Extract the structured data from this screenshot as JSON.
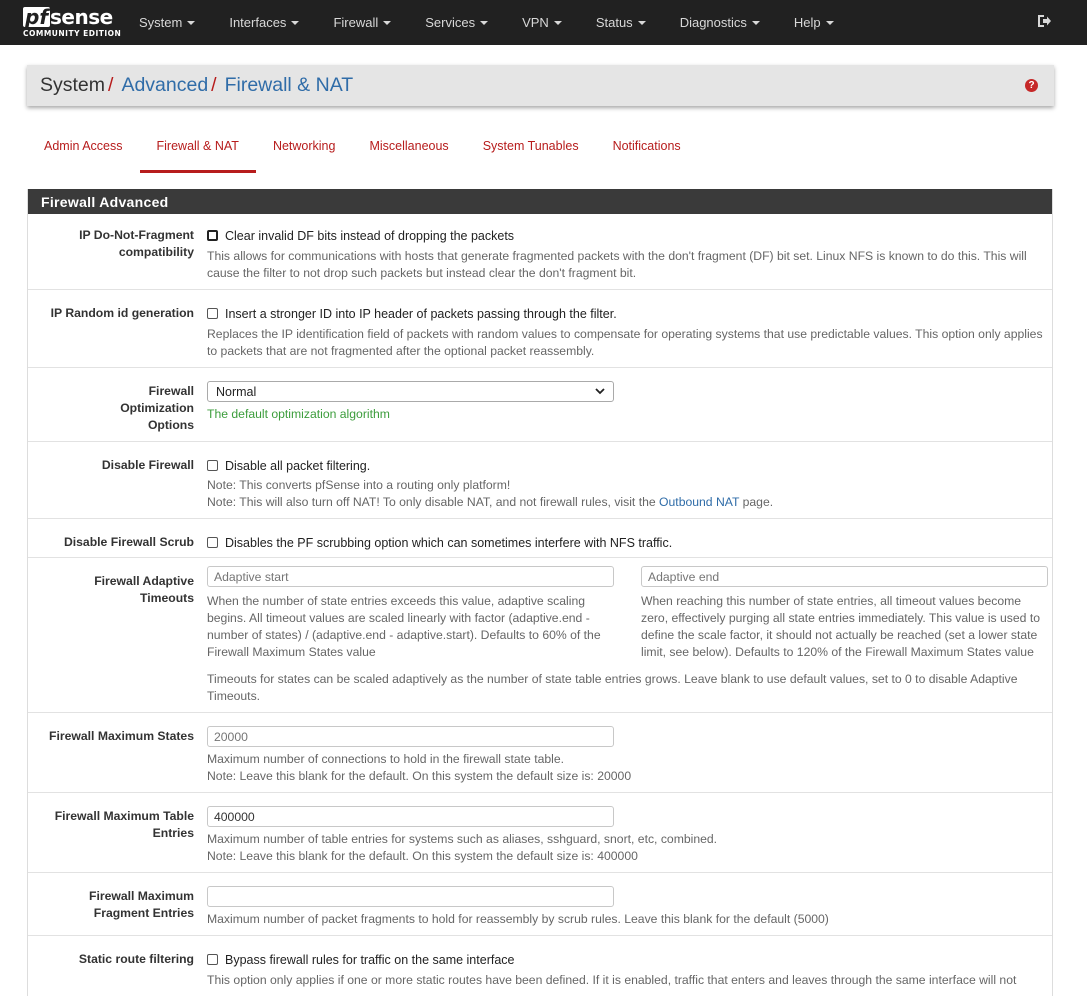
{
  "brand": {
    "name_pf": "pf",
    "name_sense": "sense",
    "edition": "COMMUNITY EDITION"
  },
  "nav": [
    {
      "label": "System"
    },
    {
      "label": "Interfaces"
    },
    {
      "label": "Firewall"
    },
    {
      "label": "Services"
    },
    {
      "label": "VPN"
    },
    {
      "label": "Status"
    },
    {
      "label": "Diagnostics"
    },
    {
      "label": "Help"
    }
  ],
  "breadcrumb": {
    "c1": "System",
    "c2": "Advanced",
    "c3": "Firewall & NAT",
    "sep": "/"
  },
  "tabs": [
    {
      "label": "Admin Access"
    },
    {
      "label": "Firewall & NAT"
    },
    {
      "label": "Networking"
    },
    {
      "label": "Miscellaneous"
    },
    {
      "label": "System Tunables"
    },
    {
      "label": "Notifications"
    }
  ],
  "panel": {
    "title": "Firewall Advanced"
  },
  "rows": {
    "df": {
      "label": "IP Do-Not-Fragment compatibility",
      "check": "Clear invalid DF bits instead of dropping the packets",
      "help": "This allows for communications with hosts that generate fragmented packets with the don't fragment (DF) bit set. Linux NFS is known to do this. This will cause the filter to not drop such packets but instead clear the don't fragment bit."
    },
    "randid": {
      "label": "IP Random id generation",
      "check": "Insert a stronger ID into IP header of packets passing through the filter.",
      "help": "Replaces the IP identification field of packets with random values to compensate for operating systems that use predictable values. This option only applies to packets that are not fragmented after the optional packet reassembly."
    },
    "opt": {
      "label": "Firewall Optimization Options",
      "value": "Normal",
      "help": "The default optimization algorithm"
    },
    "disable": {
      "label": "Disable Firewall",
      "check": "Disable all packet filtering.",
      "note1": "Note: This converts pfSense into a routing only platform!",
      "note2_pre": "Note: This will also turn off NAT! To only disable NAT, and not firewall rules, visit the ",
      "note2_link": "Outbound NAT",
      "note2_post": " page."
    },
    "scrub": {
      "label": "Disable Firewall Scrub",
      "check": "Disables the PF scrubbing option which can sometimes interfere with NFS traffic."
    },
    "adaptive": {
      "label": "Firewall Adaptive Timeouts",
      "start_placeholder": "Adaptive start",
      "end_placeholder": "Adaptive end",
      "start_help": "When the number of state entries exceeds this value, adaptive scaling begins. All timeout values are scaled linearly with factor (adaptive.end - number of states) / (adaptive.end - adaptive.start). Defaults to 60% of the Firewall Maximum States value",
      "end_help": "When reaching this number of state entries, all timeout values become zero, effectively purging all state entries immediately. This value is used to define the scale factor, it should not actually be reached (set a lower state limit, see below). Defaults to 120% of the Firewall Maximum States value",
      "help": "Timeouts for states can be scaled adaptively as the number of state table entries grows. Leave blank to use default values, set to 0 to disable Adaptive Timeouts."
    },
    "maxstates": {
      "label": "Firewall Maximum States",
      "placeholder": "20000",
      "help1": "Maximum number of connections to hold in the firewall state table.",
      "help2": "Note: Leave this blank for the default. On this system the default size is: 20000"
    },
    "maxtable": {
      "label": "Firewall Maximum Table Entries",
      "value": "400000",
      "help1": "Maximum number of table entries for systems such as aliases, sshguard, snort, etc, combined.",
      "help2": "Note: Leave this blank for the default. On this system the default size is: 400000"
    },
    "maxfrag": {
      "label": "Firewall Maximum Fragment Entries",
      "value": "",
      "help": "Maximum number of packet fragments to hold for reassembly by scrub rules. Leave this blank for the default (5000)"
    },
    "staticroute": {
      "label": "Static route filtering",
      "check": "Bypass firewall rules for traffic on the same interface",
      "help": "This option only applies if one or more static routes have been defined. If it is enabled, traffic that enters and leaves through the same interface will not"
    }
  },
  "colors": {
    "navbar": "#212121",
    "accent": "#b71c1c",
    "link": "#2f6ca8",
    "panel_head": "#3a3a3a"
  }
}
